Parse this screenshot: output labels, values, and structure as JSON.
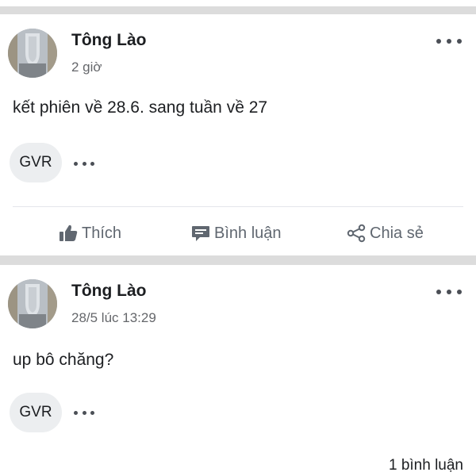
{
  "posts": [
    {
      "author": "Tông Lào",
      "time": "2 giờ",
      "content": "kết phiên về 28.6. sang tuần về 27",
      "tag": "GVR",
      "actions": {
        "like": "Thích",
        "comment": "Bình luận",
        "share": "Chia sẻ"
      }
    },
    {
      "author": "Tông Lào",
      "time": "28/5 lúc 13:29",
      "content": "up bô chăng?",
      "tag": "GVR",
      "comment_count": "1 bình luận"
    }
  ],
  "icons": {
    "avatar": "user-avatar",
    "more": "more-horizontal-icon",
    "like": "thumbs-up-icon",
    "comment": "comment-icon",
    "share": "share-icon"
  },
  "colors": {
    "separator": "#dcdcdc",
    "action_text": "#606770",
    "secondary_text": "#65676b",
    "tag_bg": "#eceef0"
  }
}
